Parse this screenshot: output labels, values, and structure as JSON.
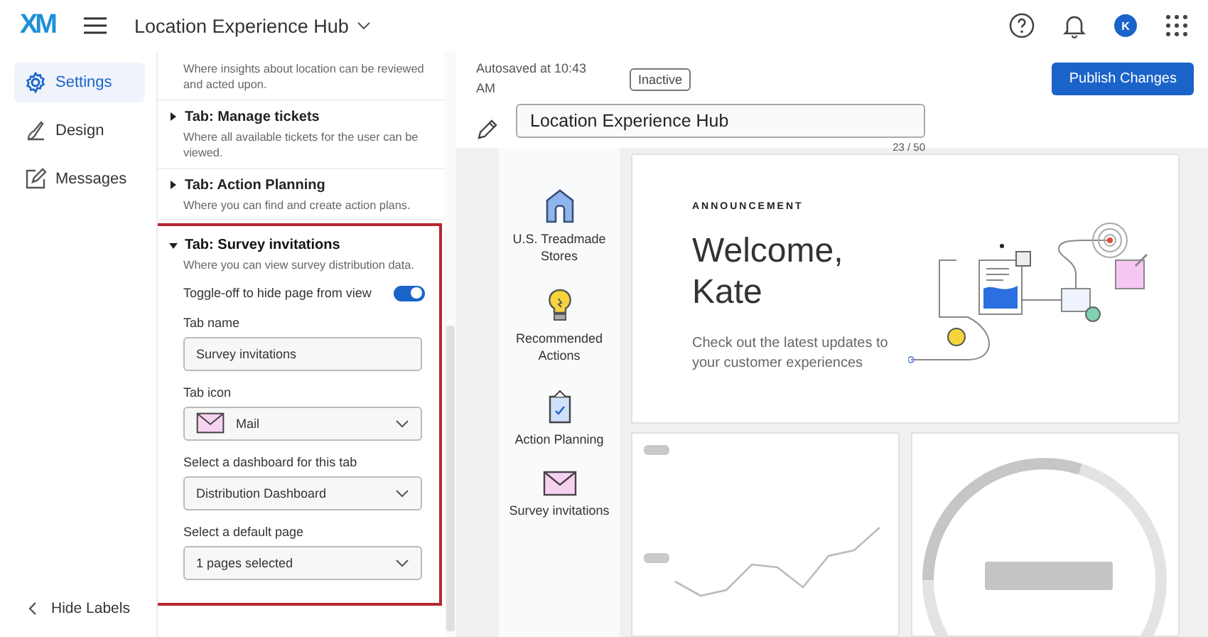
{
  "app": {
    "logo": "XM",
    "title": "Location Experience Hub",
    "avatar": "K"
  },
  "nav": [
    {
      "label": "Settings",
      "selected": true
    },
    {
      "label": "Design",
      "selected": false
    },
    {
      "label": "Messages",
      "selected": false
    }
  ],
  "hide_labels": "Hide Labels",
  "sections": [
    {
      "description": "Where insights about location can be reviewed and acted upon."
    },
    {
      "title": "Tab: Manage tickets",
      "description": "Where all available tickets for the user can be viewed.",
      "expanded": false
    },
    {
      "title": "Tab: Action Planning",
      "description": "Where you can find and create action plans.",
      "expanded": false
    },
    {
      "title": "Tab: Survey invitations",
      "description": "Where you can view survey distribution data.",
      "expanded": true,
      "highlighted": true,
      "fields": [
        {
          "kind": "toggle",
          "label": "Toggle-off to hide page from view",
          "on": true
        },
        {
          "kind": "text",
          "label": "Tab name",
          "value": "Survey invitations"
        },
        {
          "kind": "icon-select",
          "label": "Tab icon",
          "value": "Mail"
        },
        {
          "kind": "select",
          "label": "Select a dashboard for this tab",
          "value": "Distribution Dashboard"
        },
        {
          "kind": "select",
          "label": "Select a default page",
          "value": "1 pages selected"
        }
      ]
    }
  ],
  "header": {
    "autosaved": "Autosaved at 10:43 AM",
    "status": "Inactive",
    "publish": "Publish Changes",
    "name": "Location Experience Hub",
    "counter": "23 / 50"
  },
  "preview": {
    "tabs": [
      {
        "label": "U.S. Treadmade Stores"
      },
      {
        "label": "Recommended Actions"
      },
      {
        "label": "Action Planning"
      },
      {
        "label": "Survey invitations"
      }
    ],
    "announcement": {
      "kicker": "ANNOUNCEMENT",
      "heading": "Welcome, Kate",
      "body": "Check out the latest updates to your customer experiences"
    }
  }
}
